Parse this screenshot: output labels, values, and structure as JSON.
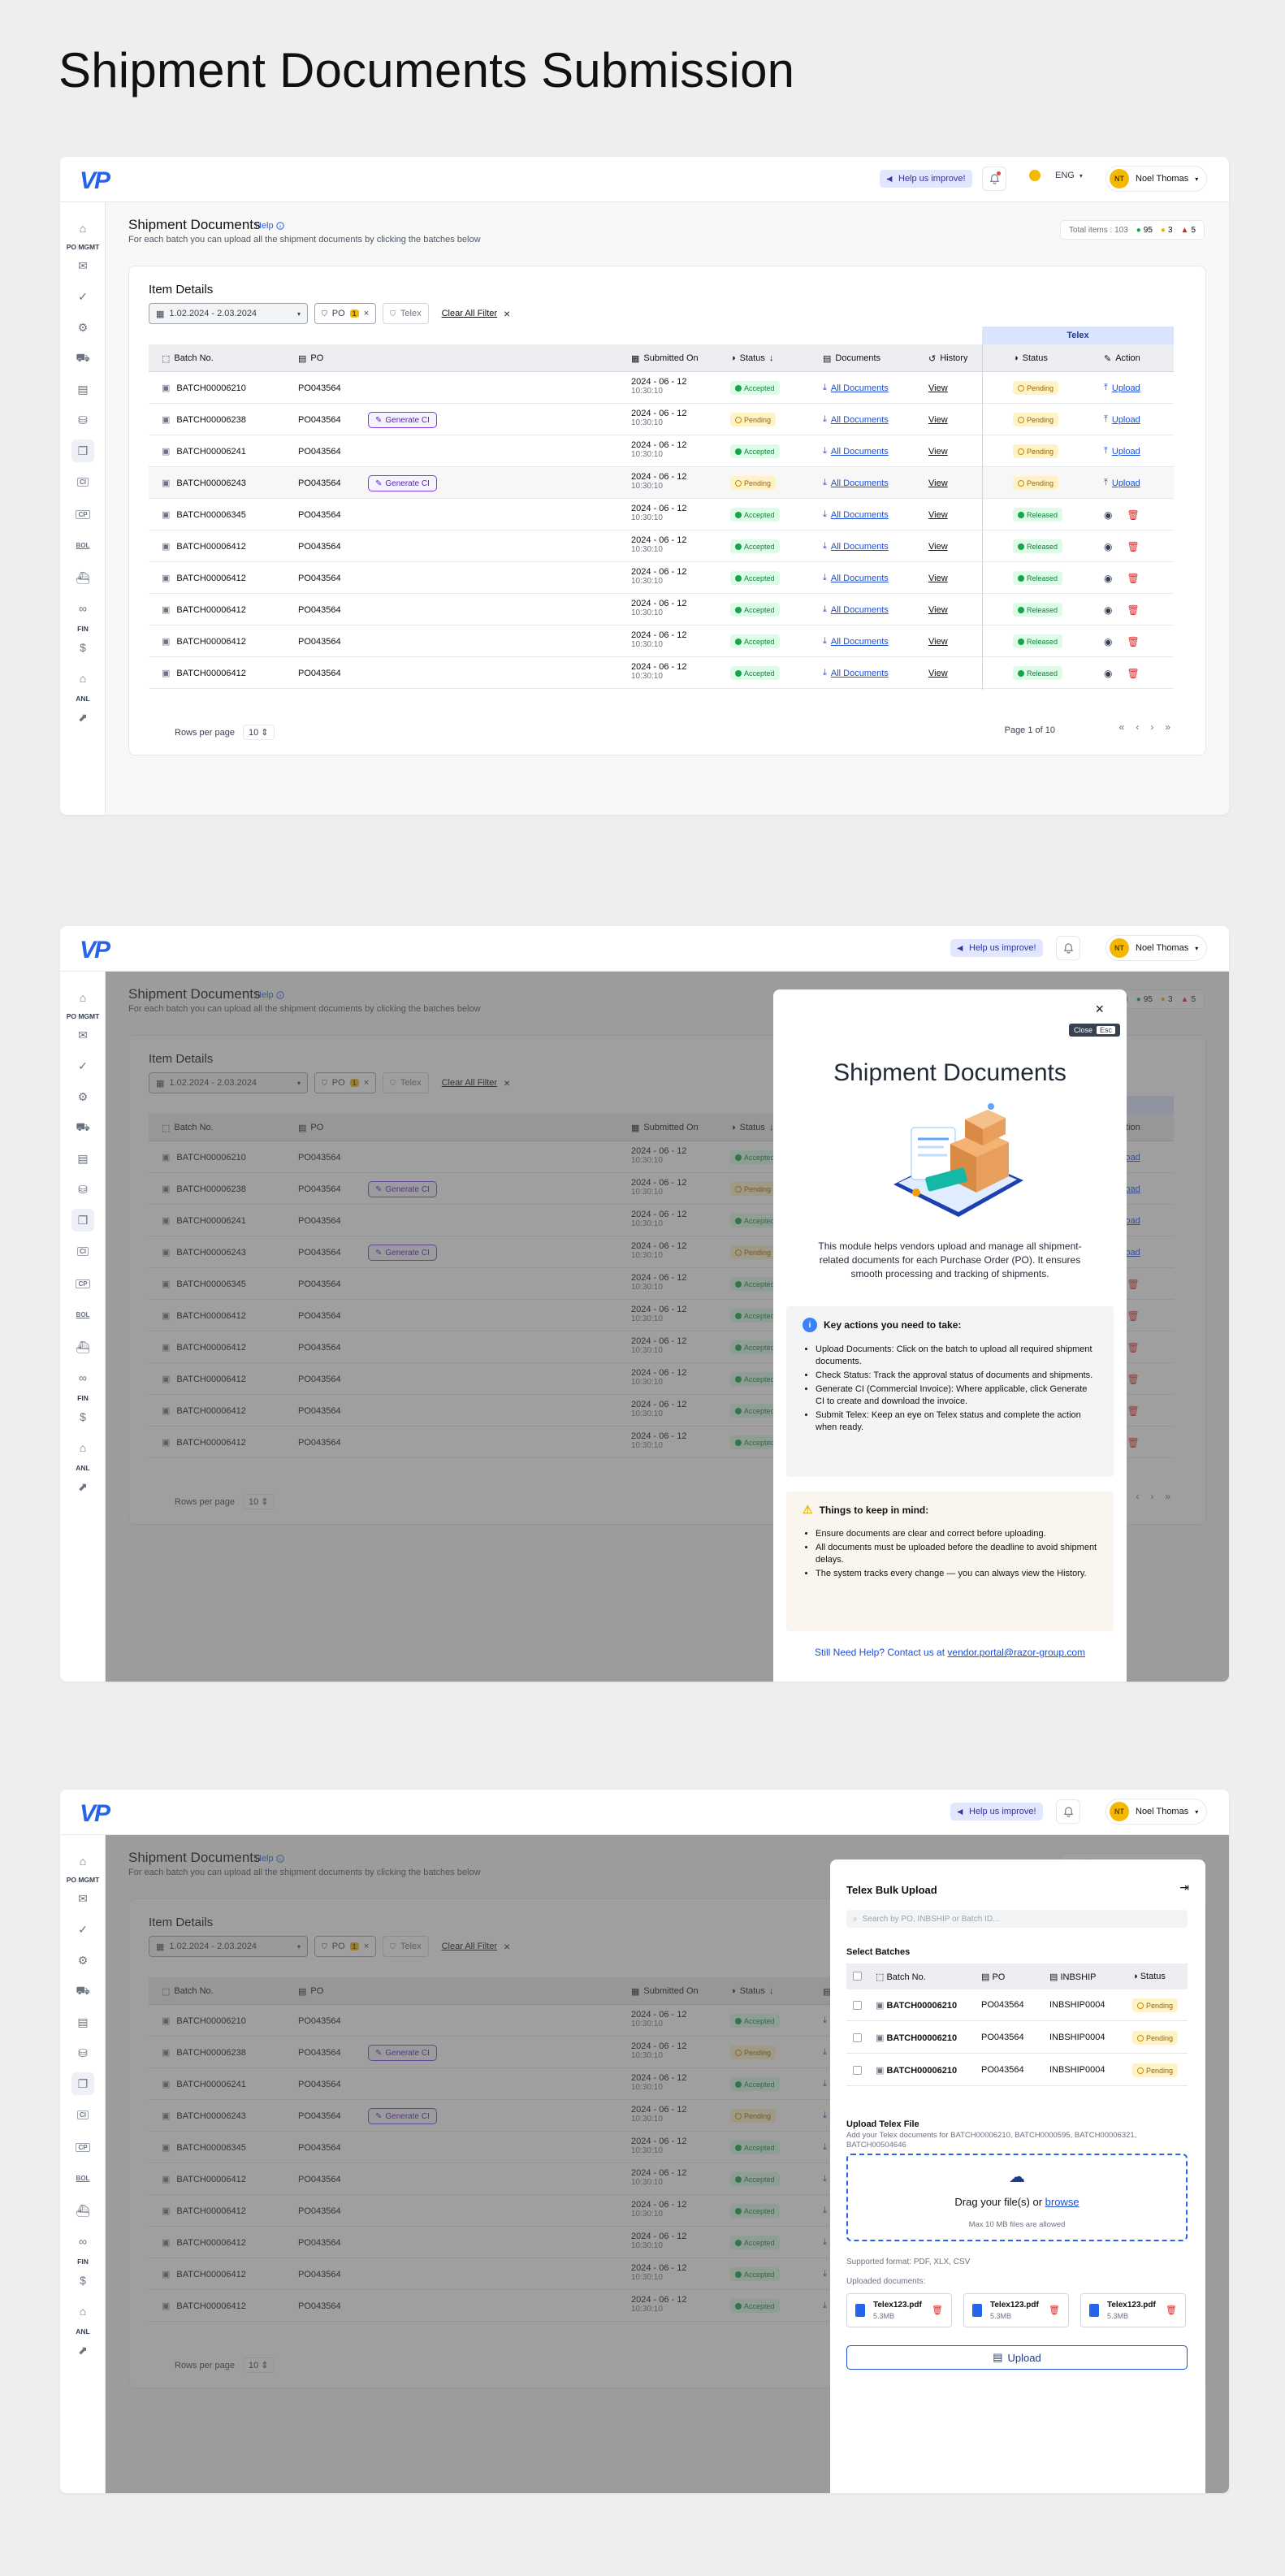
{
  "page_title": "Shipment Documents Submission",
  "app": {
    "logo": "VP",
    "help_improve": "Help us improve!",
    "lang": "ENG",
    "user_initials": "NT",
    "user_name": "Noel Thomas"
  },
  "sidebar": {
    "sections": [
      "PO MGMT",
      "FIN",
      "ANL"
    ],
    "items": [
      "home-icon",
      "mail-icon",
      "check-icon",
      "settings-icon",
      "truck-doc-icon",
      "doc-icon",
      "container-icon",
      "copy-docs-icon",
      "ci-icon",
      "cp-icon",
      "bol-icon",
      "ship-icon",
      "link-icon",
      "dollar-icon",
      "bank-icon",
      "chart-icon"
    ]
  },
  "header": {
    "title": "Shipment Documents",
    "help": "Help",
    "subtitle": "For each batch you can upload all the shipment documents by clicking the batches below",
    "total_items": "Total items : 103",
    "stat_green": "95",
    "stat_yellow": "3",
    "stat_red": "5"
  },
  "card": {
    "title": "Item Details",
    "date_range": "1.02.2024 - 2.03.2024",
    "filter_po": "PO",
    "filter_po_count": "1",
    "filter_telex": "Telex",
    "clear_all": "Clear All Filter",
    "telex_group": "Telex",
    "columns": {
      "batch": "Batch No.",
      "po": "PO",
      "submitted": "Submitted On",
      "status": "Status",
      "documents": "Documents",
      "history": "History",
      "telex_status": "Status",
      "action": "Action"
    },
    "rows_per_page_label": "Rows per page",
    "rows_per_page": "10",
    "page_info": "Page 1 of 10"
  },
  "rows": [
    {
      "batch": "BATCH00006210",
      "po": "PO043564",
      "ci": false,
      "date": "2024 - 06 - 12",
      "time": "10:30:10",
      "status": "Accepted",
      "docs": "All Documents",
      "history": "View",
      "telex": "Pending",
      "action": "Upload"
    },
    {
      "batch": "BATCH00006238",
      "po": "PO043564",
      "ci": true,
      "date": "2024 - 06 - 12",
      "time": "10:30:10",
      "status": "Pending",
      "docs": "All Documents",
      "history": "View",
      "telex": "Pending",
      "action": "Upload"
    },
    {
      "batch": "BATCH00006241",
      "po": "PO043564",
      "ci": false,
      "date": "2024 - 06 - 12",
      "time": "10:30:10",
      "status": "Accepted",
      "docs": "All Documents",
      "history": "View",
      "telex": "Pending",
      "action": "Upload"
    },
    {
      "batch": "BATCH00006243",
      "po": "PO043564",
      "ci": true,
      "date": "2024 - 06 - 12",
      "time": "10:30:10",
      "status": "Pending",
      "docs": "All Documents",
      "history": "View",
      "telex": "Pending",
      "action": "Upload"
    },
    {
      "batch": "BATCH00006345",
      "po": "PO043564",
      "ci": false,
      "date": "2024 - 06 - 12",
      "time": "10:30:10",
      "status": "Accepted",
      "docs": "All Documents",
      "history": "View",
      "telex": "Released",
      "action": ""
    },
    {
      "batch": "BATCH00006412",
      "po": "PO043564",
      "ci": false,
      "date": "2024 - 06 - 12",
      "time": "10:30:10",
      "status": "Accepted",
      "docs": "All Documents",
      "history": "View",
      "telex": "Released",
      "action": ""
    },
    {
      "batch": "BATCH00006412",
      "po": "PO043564",
      "ci": false,
      "date": "2024 - 06 - 12",
      "time": "10:30:10",
      "status": "Accepted",
      "docs": "All Documents",
      "history": "View",
      "telex": "Released",
      "action": ""
    },
    {
      "batch": "BATCH00006412",
      "po": "PO043564",
      "ci": false,
      "date": "2024 - 06 - 12",
      "time": "10:30:10",
      "status": "Accepted",
      "docs": "All Documents",
      "history": "View",
      "telex": "Released",
      "action": ""
    },
    {
      "batch": "BATCH00006412",
      "po": "PO043564",
      "ci": false,
      "date": "2024 - 06 - 12",
      "time": "10:30:10",
      "status": "Accepted",
      "docs": "All Documents",
      "history": "View",
      "telex": "Released",
      "action": ""
    },
    {
      "batch": "BATCH00006412",
      "po": "PO043564",
      "ci": false,
      "date": "2024 - 06 - 12",
      "time": "10:30:10",
      "status": "Accepted",
      "docs": "All Documents",
      "history": "View",
      "telex": "Released",
      "action": ""
    }
  ],
  "generate_ci": "Generate CI",
  "info_modal": {
    "close_tooltip": "Close",
    "close_key": "Esc",
    "title": "Shipment Documents",
    "description": "This module helps vendors upload and manage all shipment-related documents for each Purchase Order (PO). It ensures smooth processing and tracking of shipments.",
    "key_actions_title": "Key actions you need to take:",
    "key_actions": [
      "Upload Documents: Click on the batch to upload all required shipment documents.",
      "Check Status: Track the approval status of documents and shipments.",
      "Generate CI (Commercial Invoice): Where applicable, click Generate CI to create and download the invoice.",
      "Submit Telex: Keep an eye on Telex status and complete the action when ready."
    ],
    "things_title": "Things to keep in mind:",
    "things": [
      "Ensure documents are clear and correct before uploading.",
      "All documents must be uploaded before the deadline to avoid shipment delays.",
      "The system tracks every change — you can always view the History."
    ],
    "help_text": "Still Need Help? Contact us at",
    "help_email": "vendor.portal@razor-group.com"
  },
  "telex_drawer": {
    "title": "Telex Bulk Upload",
    "search_placeholder": "Search by PO, INBSHIP or Batch ID...",
    "select_label": "Select Batches",
    "columns": {
      "batch": "Batch No.",
      "po": "PO",
      "inbship": "INBSHIP",
      "status": "Status"
    },
    "rows": [
      {
        "batch": "BATCH00006210",
        "po": "PO043564",
        "inbship": "INBSHIP0004",
        "status": "Pending"
      },
      {
        "batch": "BATCH00006210",
        "po": "PO043564",
        "inbship": "INBSHIP0004",
        "status": "Pending"
      },
      {
        "batch": "BATCH00006210",
        "po": "PO043564",
        "inbship": "INBSHIP0004",
        "status": "Pending"
      }
    ],
    "upload_title": "Upload Telex File",
    "upload_sub": "Add your Telex documents for BATCH00006210, BATCH0000595, BATCH00006321, BATCH00504646",
    "drag_text": "Drag your file(s) or",
    "browse": "browse",
    "max_size": "Max 10 MB files are allowed",
    "supported": "Supported format: PDF, XLX, CSV",
    "uploaded_label": "Uploaded documents:",
    "files": [
      {
        "name": "Telex123.pdf",
        "size": "5.3MB"
      },
      {
        "name": "Telex123.pdf",
        "size": "5.3MB"
      },
      {
        "name": "Telex123.pdf",
        "size": "5.3MB"
      }
    ],
    "upload_button": "Upload"
  }
}
